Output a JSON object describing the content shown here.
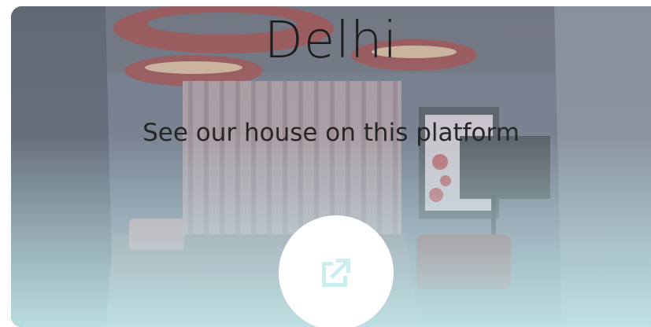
{
  "card": {
    "title": "Delhi",
    "subtitle": "See our house on this platform",
    "open_button_icon": "open-in-new-icon"
  },
  "colors": {
    "icon_accent": "#cdeef1",
    "button_bg": "#ffffff",
    "fade_bottom": "#c4eaec"
  }
}
